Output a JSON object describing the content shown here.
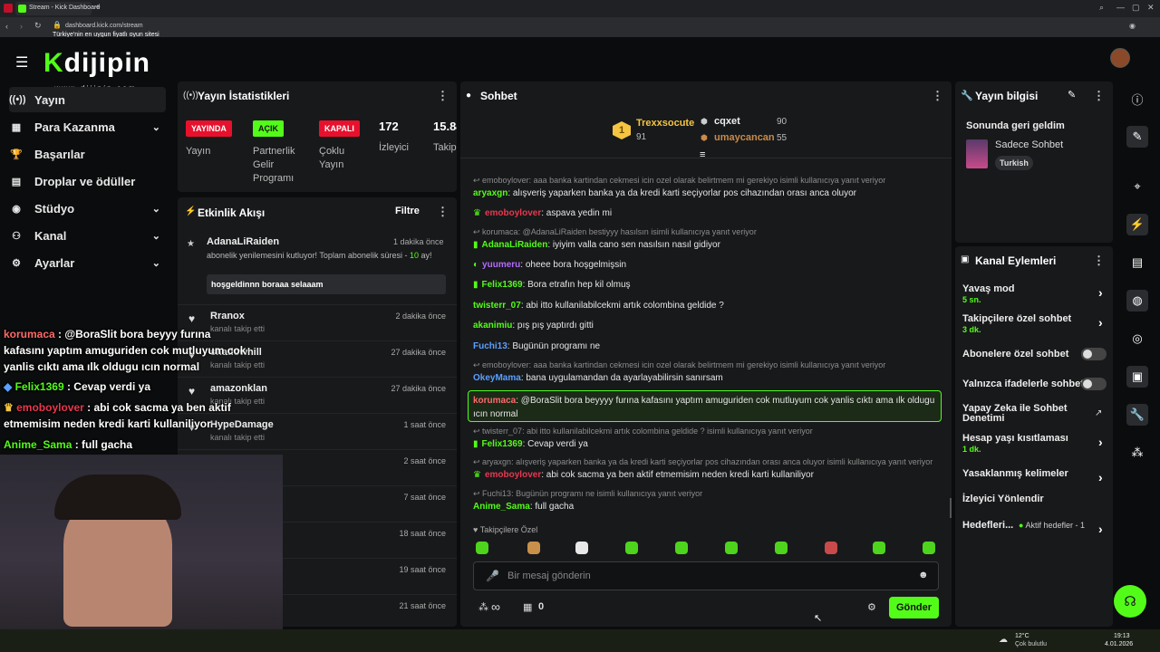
{
  "browser": {
    "tab_title": "Stream - Kick Dashboard",
    "url": "dashboard.kick.com/stream",
    "ad_text": "Türkiye'nin en uygun fiyatlı oyun sitesi",
    "watermark_url": "w w w . d i j i p i n . c o m"
  },
  "sidebar": {
    "items": [
      {
        "label": "Yayın",
        "icon": "broadcast-icon"
      },
      {
        "label": "Para Kazanma",
        "icon": "money-icon",
        "chevron": true
      },
      {
        "label": "Başarılar",
        "icon": "trophy-icon"
      },
      {
        "label": "Droplar ve ödüller",
        "icon": "gift-icon"
      },
      {
        "label": "Stüdyo",
        "icon": "studio-icon",
        "chevron": true
      },
      {
        "label": "Kanal",
        "icon": "channel-icon",
        "chevron": true
      },
      {
        "label": "Ayarlar",
        "icon": "gear-icon",
        "chevron": true
      }
    ]
  },
  "stats": {
    "title": "Yayın İstatistikleri",
    "badges": [
      {
        "text": "YAYINDA",
        "label": "Yayın"
      },
      {
        "text": "AÇIK",
        "label": "Partnerlik Gelir Programı"
      },
      {
        "text": "KAPALI",
        "label": "Çoklu Yayın"
      }
    ],
    "viewers": "172",
    "viewers_label": "İzleyici",
    "followers": "15.84",
    "followers_label": "Takip"
  },
  "activity": {
    "title": "Etkinlik Akışı",
    "filter_label": "Filtre",
    "first": {
      "name": "AdanaLiRaiden",
      "time": "1 dakika önce",
      "text_a": "abonelik yenilemesini kutluyor! Toplam abonelik süresi - ",
      "text_num": "10",
      "text_b": " ay!",
      "quote": "hoşgeldinnn boraaa selaaam"
    },
    "items": [
      {
        "name": "Rranox",
        "sub": "kanalı takip etti",
        "time": "2 dakika önce"
      },
      {
        "name": "shadowhill",
        "sub": "kanalı takip etti",
        "time": "27 dakika önce"
      },
      {
        "name": "amazonklan",
        "sub": "kanalı takip etti",
        "time": "27 dakika önce"
      },
      {
        "name": "HypeDamage",
        "sub": "kanalı takip etti",
        "time": "1 saat önce"
      },
      {
        "name": "",
        "sub": "",
        "time": "2 saat önce"
      },
      {
        "name": "",
        "sub": "",
        "time": "7 saat önce"
      },
      {
        "name": "",
        "sub": "",
        "time": "18 saat önce"
      },
      {
        "name": "",
        "sub": "",
        "time": "19 saat önce"
      },
      {
        "name": "",
        "sub": "",
        "time": "21 saat önce"
      }
    ]
  },
  "chat": {
    "title": "Sohbet",
    "leaders": [
      {
        "name": "Trexxsocute",
        "score": "91"
      },
      {
        "name": "cqxet",
        "score": "90"
      },
      {
        "name": "umaycancan",
        "score": "55"
      }
    ],
    "messages": [
      {
        "kind": "sys",
        "text": "emoboylover: aaa banka kartindan cekmesi icin ozel olarak belirtmem mi gerekiyo isimli kullanıcıya yanıt veriyor"
      },
      {
        "kind": "msg",
        "user": "aryaxgn",
        "color": "#53fc18",
        "text": ": alışveriş yaparken banka ya da kredi karti seçiyorlar pos cihazından orası anca oluyor"
      },
      {
        "kind": "msg",
        "user": "emoboylover",
        "color": "#e8384f",
        "text": ": aspava yedin mi"
      },
      {
        "kind": "sys",
        "text": "korumaca: @AdanaLiRaiden bestiyyy hasılsın isimli kullanıcıya yanıt veriyor"
      },
      {
        "kind": "msg",
        "user": "AdanaLiRaiden",
        "color": "#53fc18",
        "text": ": iyiyim valla cano sen nasılsın nasıl gidiyor"
      },
      {
        "kind": "msg",
        "user": "yuumeru",
        "color": "#b36bff",
        "text": ": oheee bora hoşgelmişsin"
      },
      {
        "kind": "msg",
        "user": "Felix1369",
        "color": "#53fc18",
        "text": ": Bora etrafın hep kil olmuş"
      },
      {
        "kind": "msg",
        "user": "twisterr_07",
        "color": "#53fc18",
        "text": ": abi itto kullanilabilcekmi artık colombina geldide ?"
      },
      {
        "kind": "msg",
        "user": "akanimiu",
        "color": "#53fc18",
        "text": ": pış pış yaptırdı gitti"
      },
      {
        "kind": "msg",
        "user": "Fuchi13",
        "color": "#5aa0ff",
        "text": ": Bugünün programı ne"
      },
      {
        "kind": "sys",
        "text": "emoboylover: aaa banka kartindan cekmesi icin ozel olarak belirtmem mi gerekiyo isimli kullanıcıya yanıt veriyor"
      },
      {
        "kind": "msg",
        "user": "OkeyMama",
        "color": "#5aa0ff",
        "text": ": bana uygulamandan da ayarlayabilirsin sanırsam"
      },
      {
        "kind": "msg",
        "user": "korumaca",
        "color": "#ff6a6a",
        "text": ": @BoraSlit bora beyyyy furına kafasını yaptım amuguriden cok mutluyum cok yanlis cıktı ama ılk"
      },
      {
        "kind": "cont",
        "text": "oldugu ıcın normal"
      },
      {
        "kind": "sys",
        "text": "twisterr_07: abi itto kullanilabilcekmi artık colombina geldide ? isimli kullanıcıya yanıt veriyor"
      },
      {
        "kind": "msg",
        "user": "Felix1369",
        "color": "#53fc18",
        "text": ": Cevap verdi ya"
      },
      {
        "kind": "sys",
        "text": "aryaxgn: alışveriş yaparken banka ya da kredi karti seçiyorlar pos cihazından orası anca oluyor isimli kullanıcıya yanıt veriyor"
      },
      {
        "kind": "msg",
        "user": "emoboylover",
        "color": "#e8384f",
        "text": ": abi cok sacma ya ben aktif etmemisim neden kredi karti kullaniliyor"
      },
      {
        "kind": "sys",
        "text": "Fuchi13: Bugünün programı ne isimli kullanıcıya yanıt veriyor"
      },
      {
        "kind": "msg",
        "user": "Anime_Sama",
        "color": "#53fc18",
        "text": ": full gacha"
      }
    ],
    "followers_only": "Takipçilere Özel",
    "input_placeholder": "Bir mesaj gönderin",
    "infinity": "∞",
    "count": "0",
    "send_label": "Gönder"
  },
  "overlay_chat": [
    {
      "user": "korumaca",
      "color": "#ff6a6a",
      "text": " : @BoraSlit bora beyyy furına"
    },
    {
      "user": "",
      "color": "#ffffff",
      "text": "kafasını yaptım amuguriden cok mutluyum cok"
    },
    {
      "user": "",
      "color": "#ffffff",
      "text": "yanlis cıktı ama ılk oldugu ıcın normal"
    },
    {
      "user": "Felix1369",
      "color": "#53fc18",
      "text": " : Cevap verdi ya"
    },
    {
      "user": "emoboylover",
      "color": "#e8384f",
      "text": " : abi cok sacma ya ben aktif"
    },
    {
      "user": "",
      "color": "#ffffff",
      "text": "etmemisim neden kredi karti kullaniliyor"
    },
    {
      "user": "Anime_Sama",
      "color": "#53fc18",
      "text": " : full gacha"
    }
  ],
  "info": {
    "title": "Yayın bilgisi",
    "stream_title": "Sonunda geri geldim",
    "category": "Sadece Sohbet",
    "language": "Turkish"
  },
  "channel_actions": {
    "title": "Kanal Eylemleri",
    "items": [
      {
        "label": "Yavaş mod",
        "sub": "5 sn."
      },
      {
        "label": "Takipçilere özel sohbet",
        "sub": "3 dk."
      },
      {
        "label": "Abonelere özel sohbet",
        "sub": ""
      },
      {
        "label": "Yalnızca ifadelerle sohbet",
        "sub": ""
      },
      {
        "label": "Yapay Zeka ile Sohbet Denetimi",
        "sub": ""
      },
      {
        "label": "Hesap yaşı kısıtlaması",
        "sub": "1 dk."
      },
      {
        "label": "Yasaklanmış kelimeler",
        "sub": ""
      },
      {
        "label": "İzleyici Yönlendir",
        "sub": ""
      },
      {
        "label": "Hedefleri...",
        "sub": "Aktif hedefler - 1"
      }
    ]
  },
  "taskbar": {
    "weather": "12°C",
    "weather_desc": "Çok bulutlu",
    "time": "19:13",
    "date": "4.01.2026"
  },
  "colors": {
    "accent": "#53fc18",
    "bg": "#0b0c0d",
    "panel": "#18191b",
    "red": "#e8384f"
  }
}
